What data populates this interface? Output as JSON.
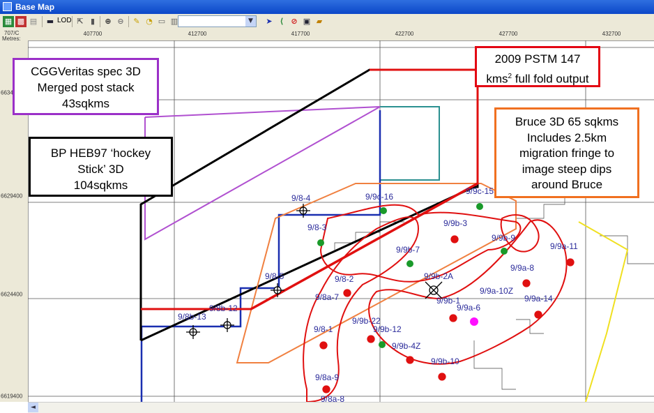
{
  "window": {
    "title": "Base Map"
  },
  "toolbar": {
    "lod_label": "LOD"
  },
  "axes": {
    "corner_top": "707/C",
    "corner_bottom": "Metres:",
    "x_ticks": [
      "407700",
      "412700",
      "417700",
      "422700",
      "427700",
      "432700"
    ],
    "y_ticks": [
      "6634...",
      "6629400",
      "6624400",
      "6619400"
    ]
  },
  "callouts": {
    "pstm": {
      "line1": "2009 PSTM 147",
      "line2_main": "kms",
      "line2_sup": "2",
      "line2_rest": " full fold output",
      "color": "#e30613"
    },
    "cggveritas": {
      "line1": "CGGVeritas spec 3D",
      "line2": "Merged post stack",
      "line3": "43sqkms",
      "color": "#9b30c8"
    },
    "bp": {
      "line1": "BP HEB97 ‘hockey",
      "line2": "Stick’ 3D",
      "line3": "104sqkms",
      "color": "#000000"
    },
    "bruce": {
      "line1": "Bruce 3D  65 sqkms",
      "line2": "Includes 2.5km",
      "line3": "migration fringe to",
      "line4": "image steep dips",
      "line5": "around Bruce",
      "color": "#f07020"
    }
  },
  "wells": {
    "w98_4": "9/8-4",
    "w98_3": "9/8-3",
    "w98_5": "9/8-5",
    "w98_2": "9/8-2",
    "w98a_7": "9/8a-7",
    "w98_1": "9/8-1",
    "w98b_13": "9/8b-13",
    "w98b_12": "9/8b-12",
    "w98a_9": "9/8a-9",
    "w98a_8": "9/8a-8",
    "w99c_16": "9/9c-16",
    "w99c_15": "9/9c-15",
    "w99b_3": "9/9b-3",
    "w99b_9": "9/9b-9",
    "w99a_11": "9/9a-11",
    "w99b_7": "9/9b-7",
    "w99b_2a": "9/9b-2A",
    "w99a_8": "9/9a-8",
    "w99a_10z": "9/9a-10Z",
    "w99b_1": "9/9b-1",
    "w99a_6": "9/9a-6",
    "w99a_14": "9/9a-14",
    "w99b_12": "9/9b-12",
    "w99b_cluster": "9/9b-22",
    "w99b_4z": "9/9b-4Z",
    "w99b_10": "9/9b-10"
  },
  "colors": {
    "pstm_outline": "#e01010",
    "bp_outline": "#000000",
    "cgg_outline": "#b050d0",
    "bruce_outline": "#f08040",
    "licence_blue": "#1a2fb0",
    "teal_block": "#2a9090",
    "field_red": "#e01010",
    "yellow_line": "#f0e020",
    "well_label": "#2a2a9a",
    "green_well": "#1a9a2a",
    "magenta_well": "#ff10ff"
  }
}
